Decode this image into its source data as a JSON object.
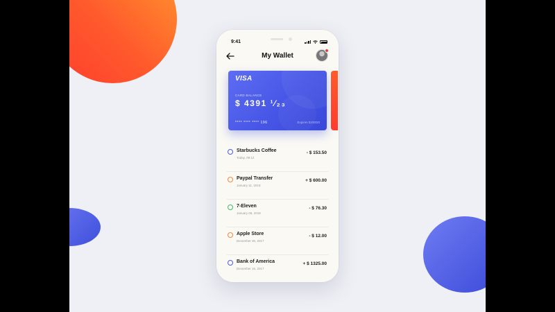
{
  "status": {
    "time": "9:41"
  },
  "header": {
    "title": "My Wallet",
    "back_icon": "arrow-left-icon",
    "avatar_icon": "user-avatar-icon"
  },
  "card": {
    "brand": "VISA",
    "balance_label": "CARD BALANCE",
    "balance": "$ 4391 ¹⁄₂₃",
    "number": "**** **** **** 196",
    "expiry": "Expires 02/2020",
    "color_from": "#5e6df2",
    "color_to": "#3848d8",
    "next_card_color": "#ff4a2e"
  },
  "transactions": [
    {
      "name": "Starbucks Coffee",
      "date": "Today, 09:12",
      "amount": "- $ 153.50",
      "ring_color": "#4a5be6"
    },
    {
      "name": "Paypal Transfer",
      "date": "January 11, 2018",
      "amount": "+ $ 600.00",
      "ring_color": "#f08a3a"
    },
    {
      "name": "7-Eleven",
      "date": "January 09, 2018",
      "amount": "- $ 76.30",
      "ring_color": "#43b86a"
    },
    {
      "name": "Apple Store",
      "date": "December 30, 2017",
      "amount": "- $ 12.00",
      "ring_color": "#f08a3a"
    },
    {
      "name": "Bank of America",
      "date": "December 16, 2017",
      "amount": "+ $ 1325.00",
      "ring_color": "#4a5be6"
    }
  ],
  "colors": {
    "background": "#eff0f5",
    "accent_orange": "#ff5a2c",
    "accent_blue": "#4756e6"
  }
}
